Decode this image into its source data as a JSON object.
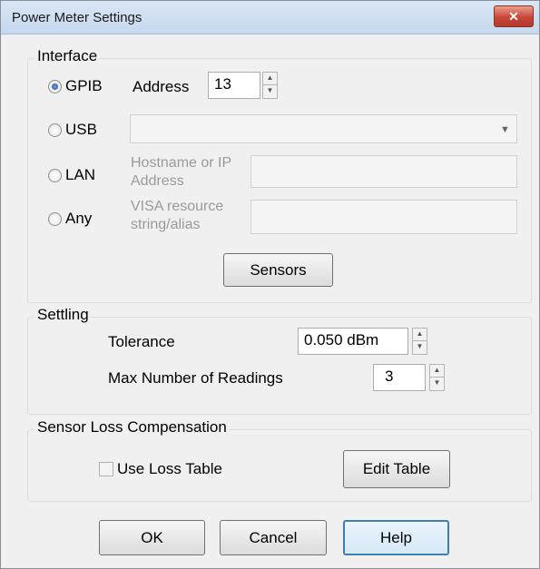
{
  "window": {
    "title": "Power Meter Settings",
    "close_glyph": "✕"
  },
  "interface": {
    "group_title": "Interface",
    "gpib": {
      "label": "GPIB",
      "selected": true,
      "address_label": "Address",
      "address_value": "13"
    },
    "usb": {
      "label": "USB",
      "selected": false,
      "value": ""
    },
    "lan": {
      "label": "LAN",
      "selected": false,
      "field_label": "Hostname or IP Address",
      "value": ""
    },
    "any": {
      "label": "Any",
      "selected": false,
      "field_label": "VISA resource string/alias",
      "value": ""
    },
    "sensors_button": "Sensors"
  },
  "settling": {
    "group_title": "Settling",
    "tolerance_label": "Tolerance",
    "tolerance_value": "0.050 dBm",
    "max_readings_label": "Max Number of Readings",
    "max_readings_value": "3"
  },
  "loss": {
    "group_title": "Sensor Loss Compensation",
    "use_loss_table_label": "Use Loss Table",
    "use_loss_table_checked": false,
    "edit_table_button": "Edit Table"
  },
  "buttons": {
    "ok": "OK",
    "cancel": "Cancel",
    "help": "Help"
  },
  "icons": {
    "spin_up": "▲",
    "spin_down": "▼",
    "dropdown": "▼"
  }
}
